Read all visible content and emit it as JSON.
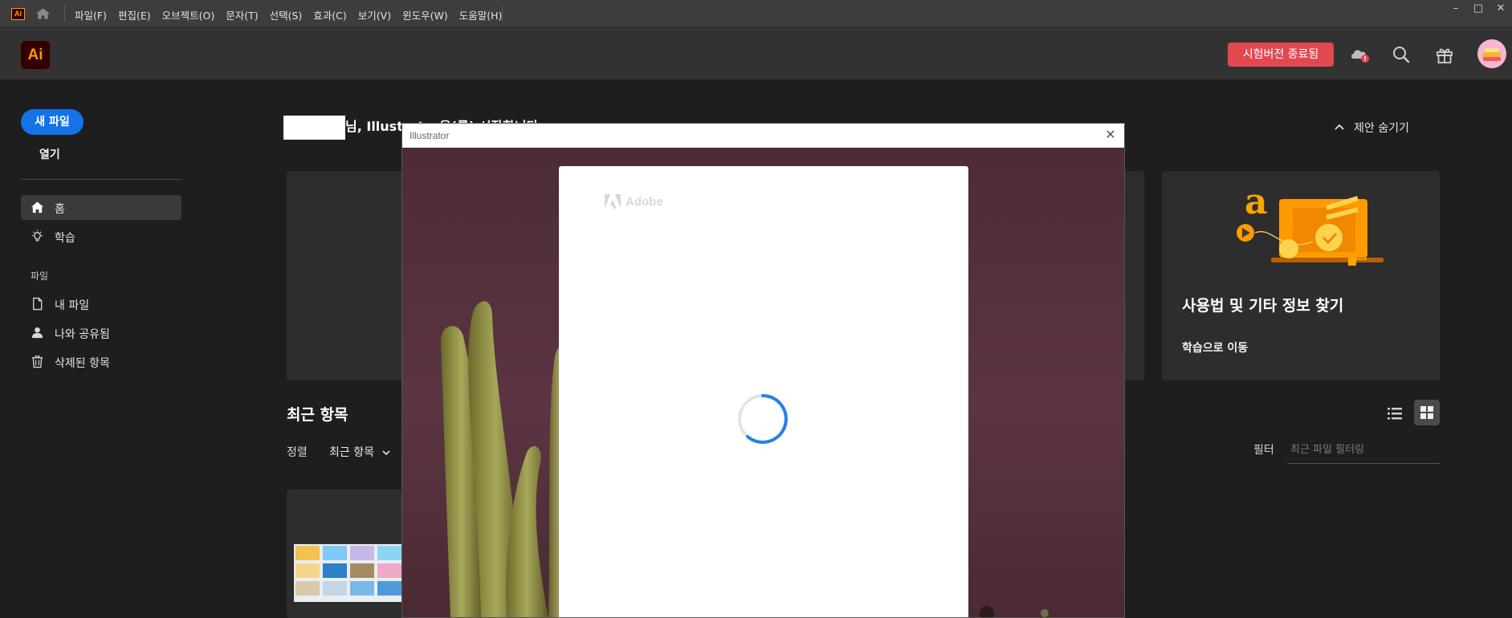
{
  "menubar": {
    "app_badge": "Ai",
    "items": [
      "파일(F)",
      "편집(E)",
      "오브젝트(O)",
      "문자(T)",
      "선택(S)",
      "효과(C)",
      "보기(V)",
      "윈도우(W)",
      "도움말(H)"
    ],
    "window_controls": [
      "–",
      "□",
      "✕"
    ]
  },
  "header": {
    "logo": "Ai",
    "trial_button": "시험버전 종료됨",
    "icons": [
      "cloud-alert-icon",
      "search-icon",
      "gift-icon"
    ]
  },
  "sidebar": {
    "new_file": "새 파일",
    "open": "열기",
    "nav": [
      {
        "label": "홈",
        "icon": "home-icon",
        "active": true
      },
      {
        "label": "학습",
        "icon": "lightbulb-icon",
        "active": false
      }
    ],
    "section_label": "파일",
    "files": [
      {
        "label": "내 파일",
        "icon": "file-icon"
      },
      {
        "label": "나와 공유됨",
        "icon": "shared-user-icon"
      },
      {
        "label": "삭제된 항목",
        "icon": "trash-icon"
      }
    ]
  },
  "main": {
    "welcome": "님, Illustrator을(를) 시작합니다",
    "hide_suggestions": "제안 숨기기",
    "learn_card": {
      "title": "사용법 및 기타 정보 찾기",
      "link": "학습으로 이동"
    },
    "recent_title": "최근 항목",
    "sort_label": "정렬",
    "sort_value": "최근 항목",
    "filter_label": "필터",
    "filter_placeholder": "최근 파일 필터링"
  },
  "modal": {
    "title": "Illustrator",
    "close": "✕",
    "brand": "Adobe"
  },
  "colors": {
    "accent_blue": "#1473e6",
    "trial_red": "#e34850",
    "ai_orange": "#ff9a00",
    "ai_bg": "#330000",
    "spinner_blue": "#2680eb"
  }
}
